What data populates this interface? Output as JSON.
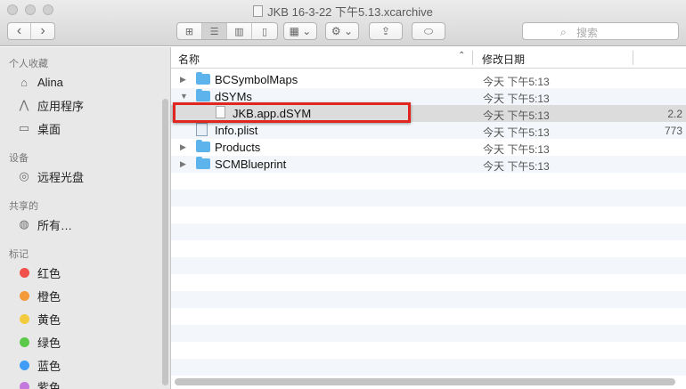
{
  "window": {
    "title": "JKB 16-3-22 下午5.13.xcarchive"
  },
  "toolbar": {
    "back_icon": "‹",
    "forward_icon": "›",
    "view_icons": [
      "⊞",
      "☰",
      "▥",
      "▯"
    ],
    "arrange_icon": "▦ ⌄",
    "action_icon": "⚙ ⌄",
    "share_icon": "⇪",
    "tag_icon": "⬭",
    "search_placeholder": "搜索",
    "search_icon": "⌕"
  },
  "sidebar": {
    "favorites_title": "个人收藏",
    "favorites": [
      {
        "label": "Alina",
        "icon": "⌂"
      },
      {
        "label": "应用程序",
        "icon": "⋀"
      },
      {
        "label": "桌面",
        "icon": "▭"
      }
    ],
    "devices_title": "设备",
    "devices": [
      {
        "label": "远程光盘",
        "icon": "◎"
      }
    ],
    "shared_title": "共享的",
    "shared": [
      {
        "label": "所有…",
        "icon": "◍"
      }
    ],
    "tags_title": "标记",
    "tags": [
      {
        "label": "红色",
        "color": "#f0514a"
      },
      {
        "label": "橙色",
        "color": "#f39a3a"
      },
      {
        "label": "黄色",
        "color": "#f3cb3e"
      },
      {
        "label": "绿色",
        "color": "#5bc94a"
      },
      {
        "label": "蓝色",
        "color": "#3f9df5"
      },
      {
        "label": "紫色",
        "color": "#c477dc"
      }
    ]
  },
  "columns": {
    "name": "名称",
    "date": "修改日期",
    "sort_icon": "⌃"
  },
  "files": [
    {
      "name": "BCSymbolMaps",
      "date": "今天 下午5:13",
      "size": "",
      "kind": "folder",
      "level": 0,
      "expanded": false
    },
    {
      "name": "dSYMs",
      "date": "今天 下午5:13",
      "size": "",
      "kind": "folder",
      "level": 0,
      "expanded": true
    },
    {
      "name": "JKB.app.dSYM",
      "date": "今天 下午5:13",
      "size": "2.2",
      "kind": "file",
      "level": 1,
      "selected": true
    },
    {
      "name": "Info.plist",
      "date": "今天 下午5:13",
      "size": "773",
      "kind": "plist",
      "level": 0
    },
    {
      "name": "Products",
      "date": "今天 下午5:13",
      "size": "",
      "kind": "folder",
      "level": 0,
      "expanded": false
    },
    {
      "name": "SCMBlueprint",
      "date": "今天 下午5:13",
      "size": "",
      "kind": "folder",
      "level": 0,
      "expanded": false
    }
  ]
}
